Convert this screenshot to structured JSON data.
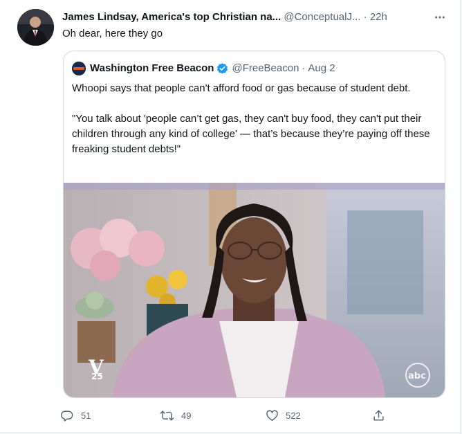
{
  "tweet": {
    "author_name": "James Lindsay, America's top Christian na...",
    "author_handle": "@ConceptualJ...",
    "separator": "·",
    "timestamp": "22h",
    "text": "Oh dear, here they go",
    "more_icon": "more-horizontal-icon"
  },
  "quoted_tweet": {
    "author_name": "Washington Free Beacon",
    "verified_icon": "verified-badge-icon",
    "author_handle": "@FreeBeacon",
    "separator": "·",
    "date": "Aug 2",
    "text_paragraphs": [
      "Whoopi says that people can't afford food or gas because of student debt.",
      "\"You talk about 'people can’t get gas, they can't buy food, they can't put their children through any kind of college' — that’s because they’re paying off these freaking student debts!\""
    ],
    "media": {
      "kind": "video-thumbnail",
      "overlay_left_logo": "V",
      "overlay_left_number": "25",
      "overlay_right_logo": "abc"
    }
  },
  "actions": {
    "reply": {
      "icon": "reply-icon",
      "count": "51"
    },
    "retweet": {
      "icon": "retweet-icon",
      "count": "49"
    },
    "like": {
      "icon": "heart-icon",
      "count": "522"
    },
    "share": {
      "icon": "share-icon"
    }
  },
  "colors": {
    "text_primary": "#0f1419",
    "text_secondary": "#536471",
    "border": "#cfd9de",
    "verified_blue": "#1d9bf0"
  }
}
